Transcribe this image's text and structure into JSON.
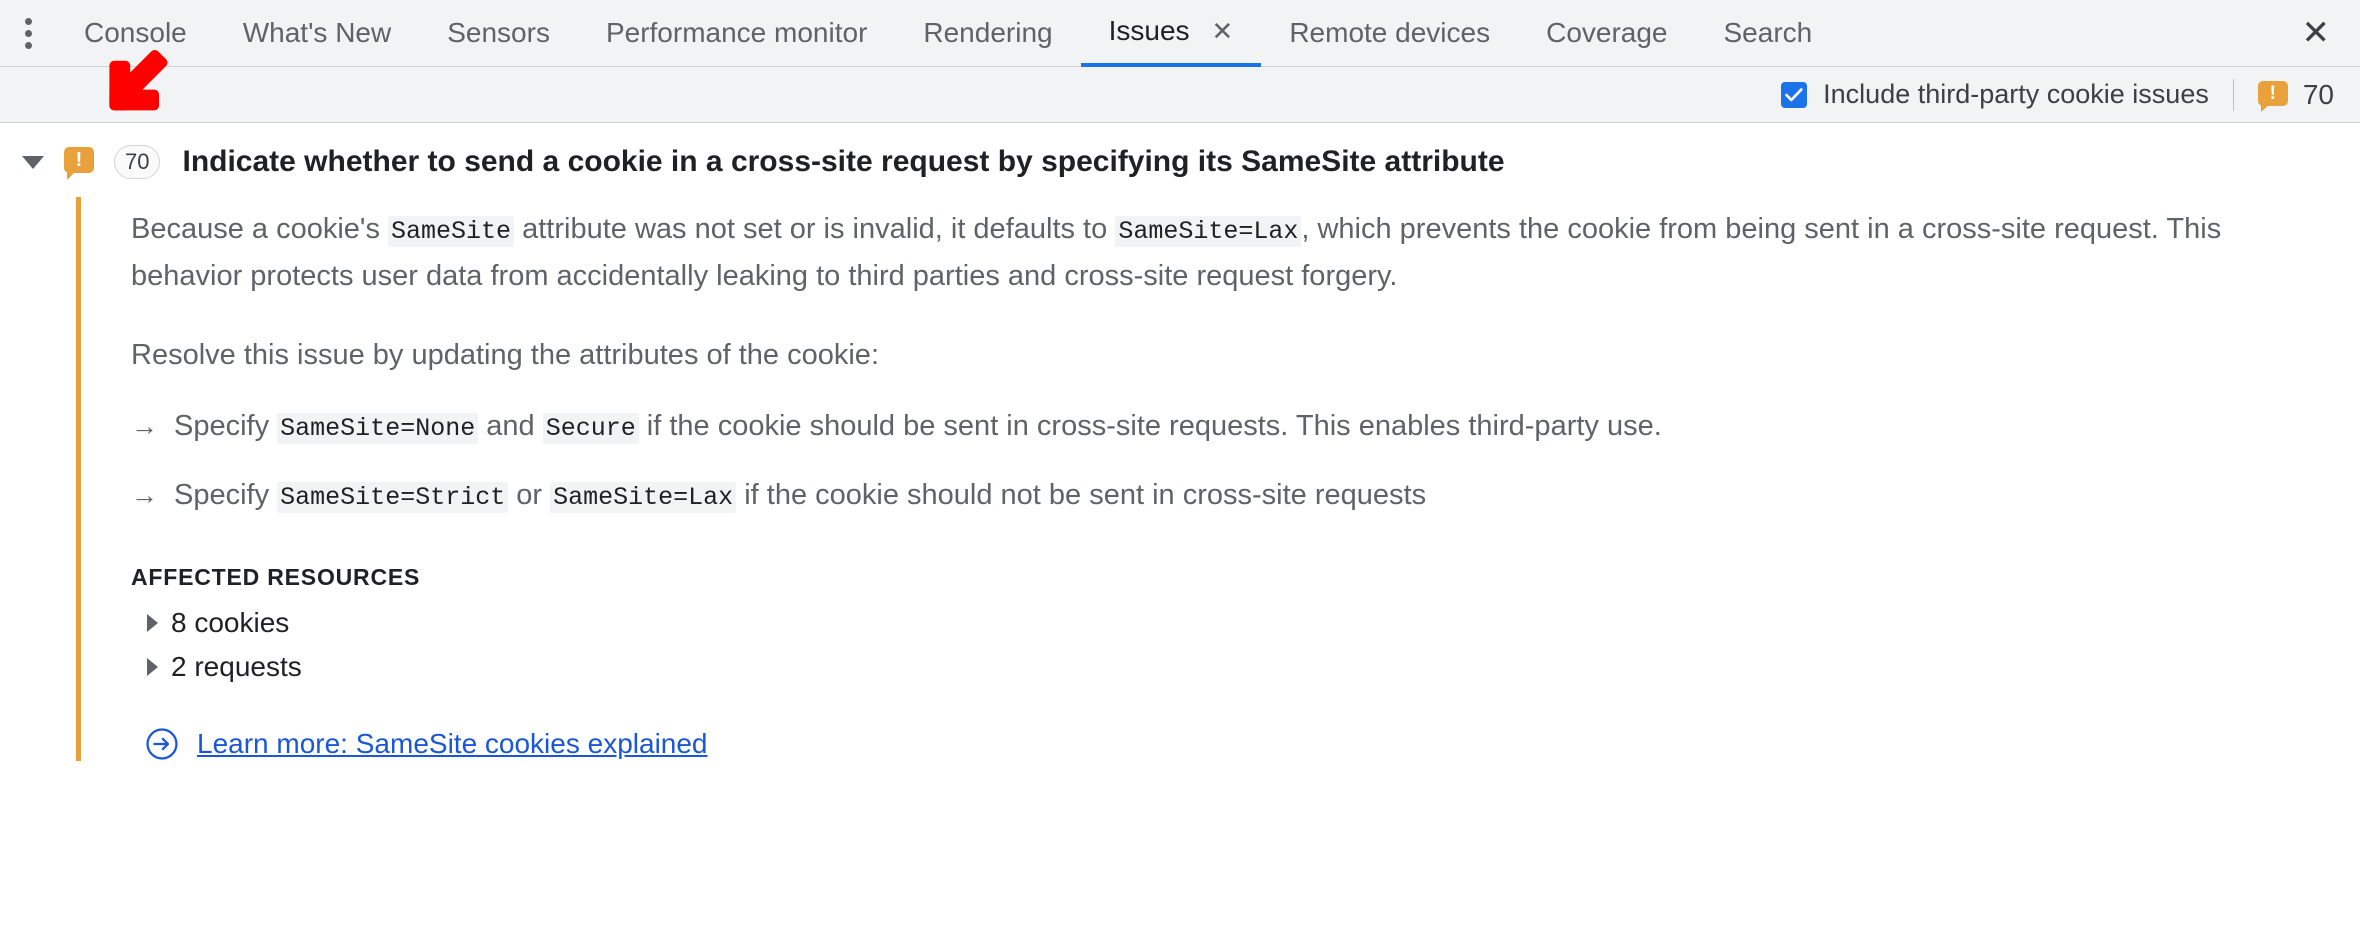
{
  "tabbar": {
    "menu_icon": "kebab-menu-icon",
    "close_icon": "✕",
    "tabs": [
      {
        "label": "Console",
        "active": false,
        "closable": false
      },
      {
        "label": "What's New",
        "active": false,
        "closable": false
      },
      {
        "label": "Sensors",
        "active": false,
        "closable": false
      },
      {
        "label": "Performance monitor",
        "active": false,
        "closable": false
      },
      {
        "label": "Rendering",
        "active": false,
        "closable": false
      },
      {
        "label": "Issues",
        "active": true,
        "closable": true
      },
      {
        "label": "Remote devices",
        "active": false,
        "closable": false
      },
      {
        "label": "Coverage",
        "active": false,
        "closable": false
      },
      {
        "label": "Search",
        "active": false,
        "closable": false
      }
    ],
    "tab_close_glyph": "✕",
    "active_underline_color": "#1a73e8"
  },
  "toolbar": {
    "third_party_checkbox_label": "Include third-party cookie issues",
    "third_party_checkbox_checked": true,
    "checkbox_color": "#1a73e8",
    "warning_icon": "warning-bubble-icon",
    "warning_glyph": "!",
    "warning_count": "70",
    "warning_color": "#e9a23b"
  },
  "issue": {
    "expanded": true,
    "caret_icon": "triangle-down-icon",
    "warning_icon": "warning-bubble-icon",
    "warning_glyph": "!",
    "count_badge": "70",
    "title": "Indicate whether to send a cookie in a cross-site request by specifying its SameSite attribute",
    "accent_color": "#e9a23b",
    "paragraph_1": {
      "part_1": "Because a cookie's ",
      "code_1": "SameSite",
      "part_2": " attribute was not set or is invalid, it defaults to ",
      "code_2": "SameSite=Lax",
      "part_3": ", which prevents the cookie from being sent in a cross-site request. This behavior protects user data from accidentally leaking to third parties and cross-site request forgery."
    },
    "paragraph_2": "Resolve this issue by updating the attributes of the cookie:",
    "bullets": [
      {
        "arrow": "→",
        "part_1": "Specify ",
        "code_1": "SameSite=None",
        "part_2": " and ",
        "code_2": "Secure",
        "part_3": " if the cookie should be sent in cross-site requests. This enables third-party use."
      },
      {
        "arrow": "→",
        "part_1": "Specify ",
        "code_1": "SameSite=Strict",
        "part_2": " or ",
        "code_2": "SameSite=Lax",
        "part_3": " if the cookie should not be sent in cross-site requests"
      }
    ],
    "affected_resources_title": "AFFECTED RESOURCES",
    "resources": [
      {
        "label": "8 cookies",
        "caret_icon": "triangle-right-icon"
      },
      {
        "label": "2 requests",
        "caret_icon": "triangle-right-icon"
      }
    ],
    "learn_more": {
      "icon": "arrow-circle-right-icon",
      "label": "Learn more: SameSite cookies explained",
      "color": "#1a57d6"
    }
  },
  "annotation": {
    "arrow_icon": "red-pointer-arrow-icon",
    "color": "#ff0000",
    "direction": "down-left"
  }
}
